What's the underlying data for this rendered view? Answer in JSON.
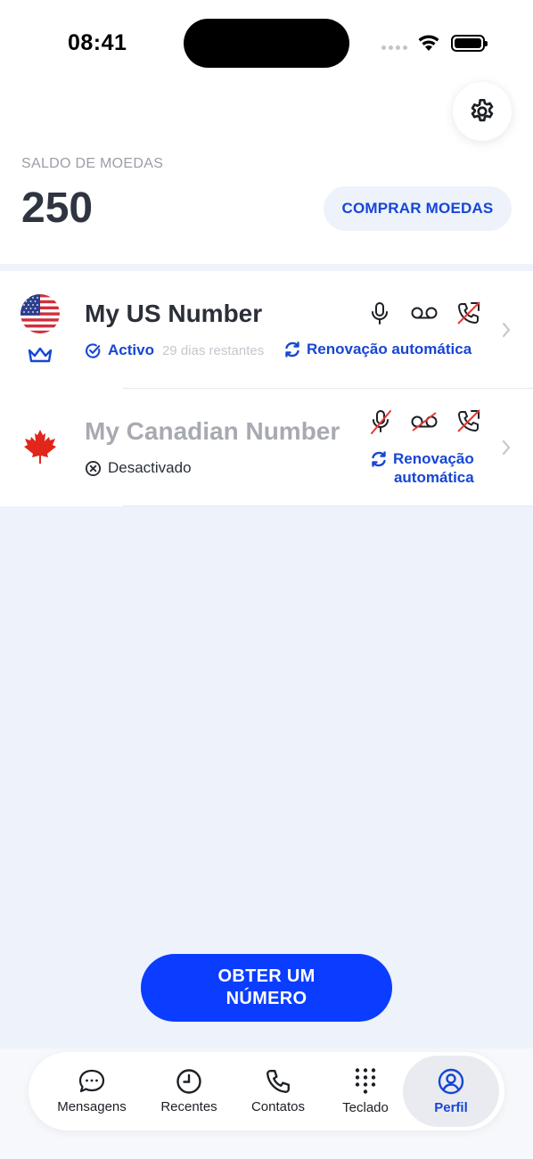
{
  "status_bar": {
    "time": "08:41"
  },
  "header": {
    "balance_label": "SALDO DE MOEDAS",
    "balance_value": "250",
    "buy_button": "COMPRAR MOEDAS"
  },
  "numbers": [
    {
      "name": "My US Number",
      "flag": "us-flag",
      "status": "Activo",
      "days_left": "29 dias restantes",
      "renew": "Renovação automática",
      "features": {
        "calls": true,
        "voicemail": true,
        "forwarding": false
      },
      "premium": true
    },
    {
      "name": "My Canadian Number",
      "flag": "canada-flag",
      "status": "Desactivado",
      "renew_line1": "Renovação",
      "renew_line2": "automática",
      "features": {
        "calls": false,
        "voicemail": false,
        "forwarding": false
      },
      "premium": false
    }
  ],
  "get_number_button": "OBTER UM NÚMERO",
  "tabs": [
    {
      "label": "Mensagens",
      "icon": "chat-icon"
    },
    {
      "label": "Recentes",
      "icon": "clock-icon"
    },
    {
      "label": "Contatos",
      "icon": "phone-icon"
    },
    {
      "label": "Teclado",
      "icon": "keypad-icon"
    },
    {
      "label": "Perfil",
      "icon": "profile-icon",
      "active": true
    }
  ],
  "colors": {
    "accent": "#1746d4",
    "primary_button": "#0a3dff",
    "background": "#eef2fb",
    "strike": "#e53935"
  }
}
